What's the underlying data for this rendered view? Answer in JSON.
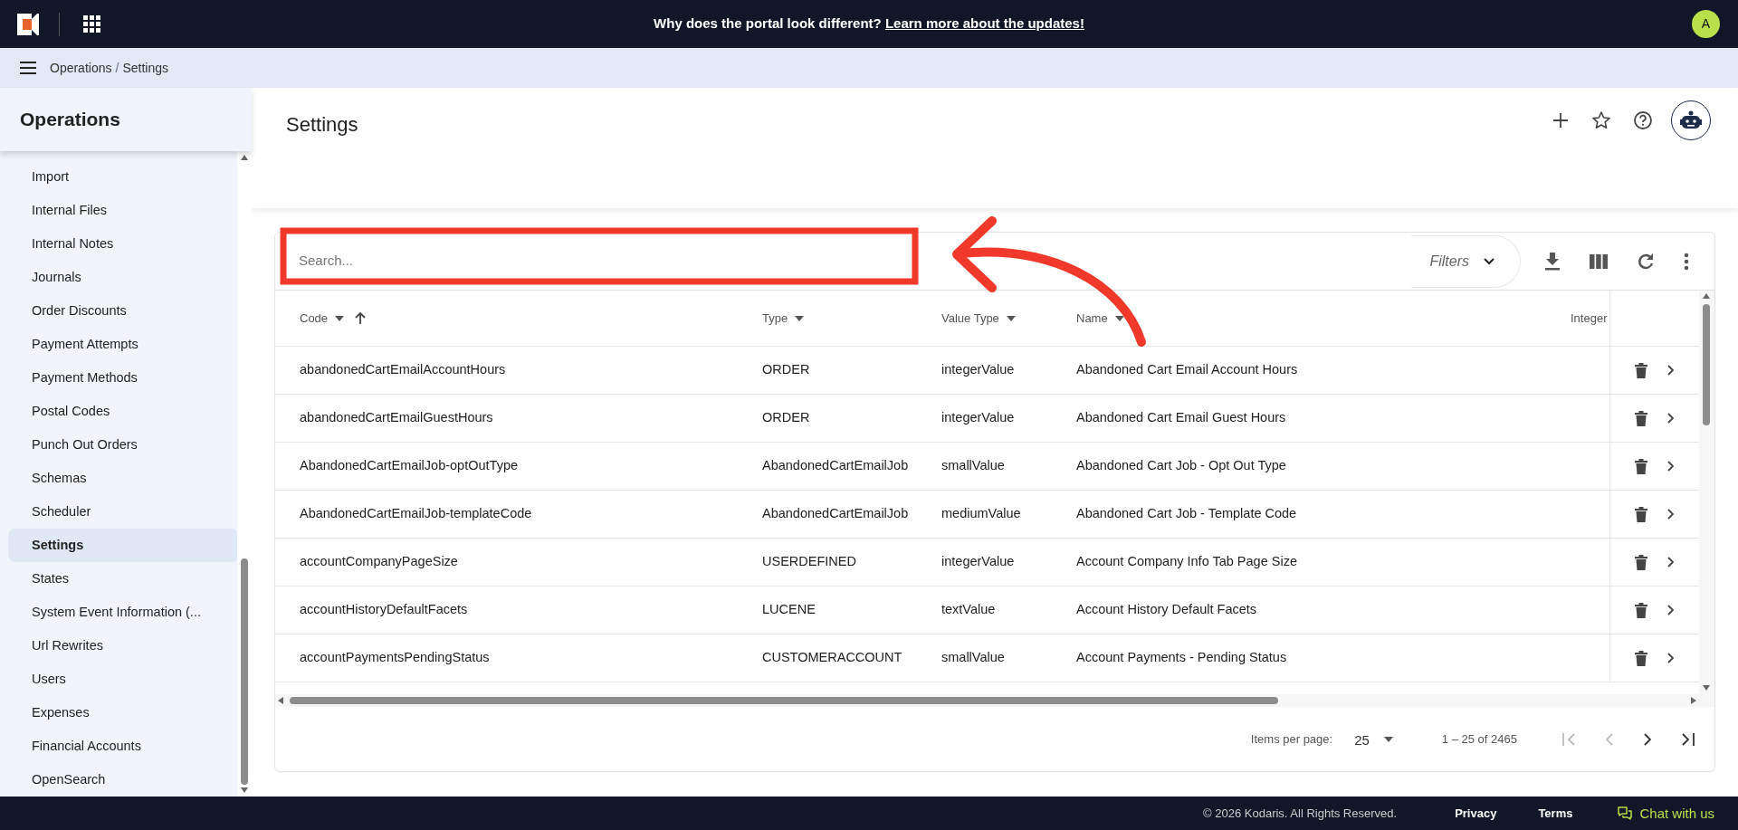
{
  "top_bar": {
    "banner_text": "Why does the portal look different?",
    "banner_link": "Learn more about the updates!",
    "avatar": "A"
  },
  "breadcrumb": [
    "Operations",
    "Settings"
  ],
  "breadcrumb_separator": "/",
  "sidebar": {
    "title": "Operations",
    "items": [
      {
        "label": "Import",
        "selected": false
      },
      {
        "label": "Internal Files",
        "selected": false
      },
      {
        "label": "Internal Notes",
        "selected": false
      },
      {
        "label": "Journals",
        "selected": false
      },
      {
        "label": "Order Discounts",
        "selected": false
      },
      {
        "label": "Payment Attempts",
        "selected": false
      },
      {
        "label": "Payment Methods",
        "selected": false
      },
      {
        "label": "Postal Codes",
        "selected": false
      },
      {
        "label": "Punch Out Orders",
        "selected": false
      },
      {
        "label": "Schemas",
        "selected": false
      },
      {
        "label": "Scheduler",
        "selected": false
      },
      {
        "label": "Settings",
        "selected": true
      },
      {
        "label": "States",
        "selected": false
      },
      {
        "label": "System Event Information (...",
        "selected": false
      },
      {
        "label": "Url Rewrites",
        "selected": false
      },
      {
        "label": "Users",
        "selected": false
      },
      {
        "label": "Expenses",
        "selected": false
      },
      {
        "label": "Financial Accounts",
        "selected": false
      },
      {
        "label": "OpenSearch",
        "selected": false
      }
    ]
  },
  "page": {
    "title": "Settings"
  },
  "table": {
    "search": {
      "placeholder": "Search..."
    },
    "filters_label": "Filters",
    "columns": [
      {
        "label": "Code",
        "filter": true,
        "sorted": true
      },
      {
        "label": "Type",
        "filter": true,
        "sorted": false
      },
      {
        "label": "Value Type",
        "filter": true,
        "sorted": false
      },
      {
        "label": "Name",
        "filter": true,
        "sorted": false
      },
      {
        "label": "Integer",
        "filter": false,
        "sorted": false
      }
    ],
    "rows": [
      {
        "code": "abandonedCartEmailAccountHours",
        "type": "ORDER",
        "value_type": "integerValue",
        "name": "Abandoned Cart Email Account Hours"
      },
      {
        "code": "abandonedCartEmailGuestHours",
        "type": "ORDER",
        "value_type": "integerValue",
        "name": "Abandoned Cart Email Guest Hours"
      },
      {
        "code": "AbandonedCartEmailJob-optOutType",
        "type": "AbandonedCartEmailJob",
        "value_type": "smallValue",
        "name": "Abandoned Cart Job - Opt Out Type"
      },
      {
        "code": "AbandonedCartEmailJob-templateCode",
        "type": "AbandonedCartEmailJob",
        "value_type": "mediumValue",
        "name": "Abandoned Cart Job - Template Code"
      },
      {
        "code": "accountCompanyPageSize",
        "type": "USERDEFINED",
        "value_type": "integerValue",
        "name": "Account Company Info Tab Page Size"
      },
      {
        "code": "accountHistoryDefaultFacets",
        "type": "LUCENE",
        "value_type": "textValue",
        "name": "Account History Default Facets"
      },
      {
        "code": "accountPaymentsPendingStatus",
        "type": "CUSTOMERACCOUNT",
        "value_type": "smallValue",
        "name": "Account Payments - Pending Status"
      }
    ]
  },
  "pager": {
    "items_per_page_label": "Items per page:",
    "page_size": "25",
    "range": "1 – 25 of 2465"
  },
  "footer": {
    "copyright": "© 2026 Kodaris. All Rights Reserved.",
    "links": [
      "Privacy",
      "Terms"
    ],
    "chat": "Chat with us"
  },
  "annotation": {
    "kind": "highlight-arrow"
  }
}
